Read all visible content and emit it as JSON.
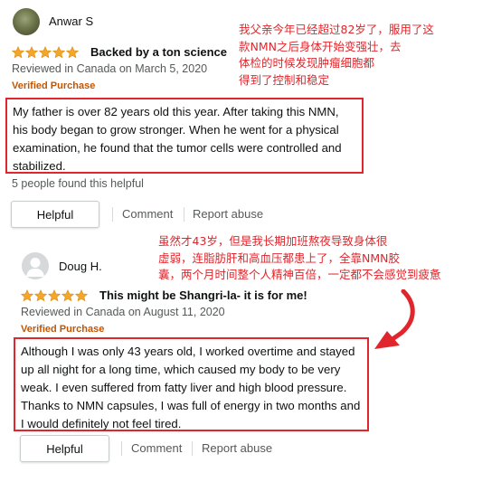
{
  "colors": {
    "star": "#f4a62a",
    "verified": "#c45500",
    "highlight": "#e0262c",
    "muted": "#565959"
  },
  "reviews": [
    {
      "avatar": "photo-avatar",
      "name": "Anwar S",
      "rating": 5,
      "title": "Backed by a ton science",
      "date": "Reviewed in Canada on March 5, 2020",
      "verified": "Verified Purchase",
      "body": "My father is over 82 years old this year. After taking this NMN, his body began to grow stronger. When he went for a physical examination, he found that the tumor cells were controlled and stabilized.",
      "helpful_count": "5 people found this helpful",
      "helpful_label": "Helpful",
      "comment_label": "Comment",
      "report_label": "Report abuse",
      "annotation": "我父亲今年已经超过82岁了，服用了这款NMN之后身体开始变强壮，去体检的时候发现肿瘤细胞都得到了控制和稳定"
    },
    {
      "avatar": "default-avatar",
      "name": "Doug H.",
      "rating": 5,
      "title": "This might be Shangri-la- it is for me!",
      "date": "Reviewed in Canada on August 11, 2020",
      "verified": "Verified Purchase",
      "body": "Although I was only 43 years old, I worked overtime and stayed up all night for a long time, which caused my body to be very weak. I even suffered from fatty liver and high blood pressure. Thanks to NMN capsules, I was full of energy in two months and I would definitely not feel tired.",
      "helpful_label": "Helpful",
      "comment_label": "Comment",
      "report_label": "Report abuse",
      "annotation": "虽然才43岁，但是我长期加班熬夜导致身体很虚弱，连脂肪肝和高血压都患上了，全靠NMN胶囊，两个月时间整个人精神百倍，一定都不会感觉到疲惫"
    }
  ]
}
